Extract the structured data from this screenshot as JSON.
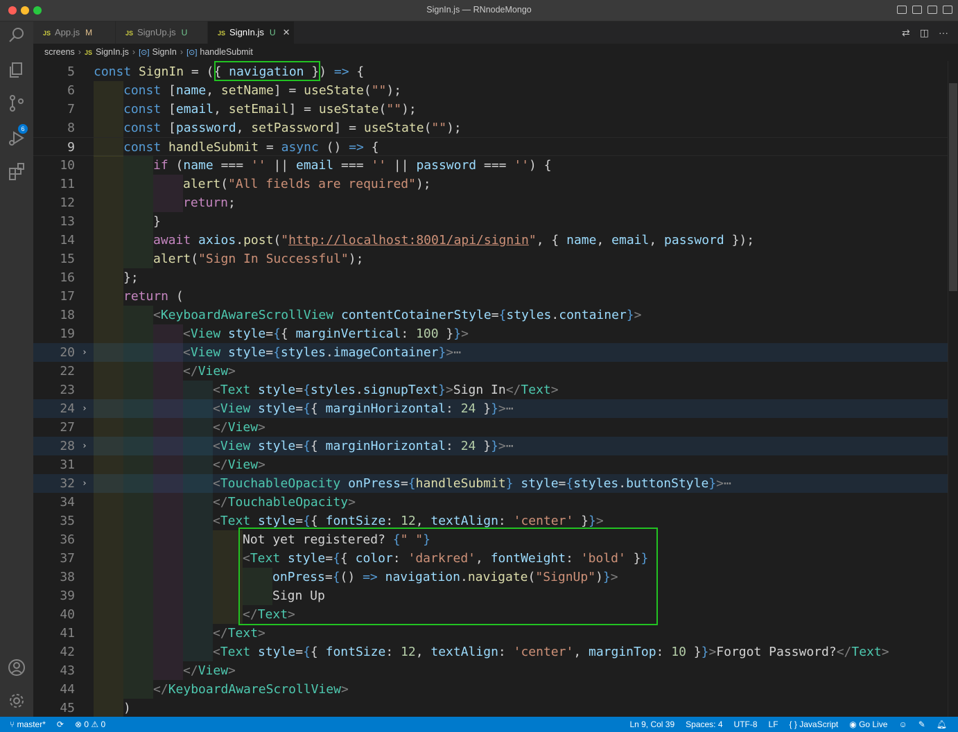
{
  "window": {
    "title": "SignIn.js — RNnodeMongo"
  },
  "activity_bar": {
    "icons": [
      "explorer-icon",
      "search-icon",
      "source-control-icon",
      "run-debug-icon",
      "extensions-icon",
      "account-icon",
      "manage-gear-icon"
    ],
    "source_control_badge": "6"
  },
  "tabs": [
    {
      "label": "App.js",
      "status": "M",
      "active": false
    },
    {
      "label": "SignUp.js",
      "status": "U",
      "active": false
    },
    {
      "label": "SignIn.js",
      "status": "U",
      "active": true
    }
  ],
  "breadcrumb": {
    "folder": "screens",
    "file": "SignIn.js",
    "component": "SignIn",
    "function": "handleSubmit",
    "file_icon": "JS"
  },
  "editor": {
    "current_line": "9",
    "lines": [
      {
        "n": "5"
      },
      {
        "n": "6"
      },
      {
        "n": "7"
      },
      {
        "n": "8"
      },
      {
        "n": "9"
      },
      {
        "n": "10"
      },
      {
        "n": "11"
      },
      {
        "n": "12"
      },
      {
        "n": "13"
      },
      {
        "n": "14"
      },
      {
        "n": "15"
      },
      {
        "n": "16"
      },
      {
        "n": "17"
      },
      {
        "n": "18"
      },
      {
        "n": "19"
      },
      {
        "n": "20"
      },
      {
        "n": "22"
      },
      {
        "n": "23"
      },
      {
        "n": "24"
      },
      {
        "n": "27"
      },
      {
        "n": "28"
      },
      {
        "n": "31"
      },
      {
        "n": "32"
      },
      {
        "n": "34"
      },
      {
        "n": "35"
      },
      {
        "n": "36"
      },
      {
        "n": "37"
      },
      {
        "n": "38"
      },
      {
        "n": "39"
      },
      {
        "n": "40"
      },
      {
        "n": "41"
      },
      {
        "n": "42"
      },
      {
        "n": "43"
      },
      {
        "n": "44"
      },
      {
        "n": "45"
      }
    ]
  },
  "statusbar": {
    "branch": "master*",
    "errors": "0",
    "warnings": "0",
    "cursor": "Ln 9, Col 39",
    "spaces": "Spaces: 4",
    "encoding": "UTF-8",
    "eol": "LF",
    "language": "JavaScript",
    "go_live": "Go Live"
  },
  "colors": {
    "statusbar": "#007acc",
    "highlight_box": "#22c322",
    "editor_bg": "#1e1e1e"
  }
}
